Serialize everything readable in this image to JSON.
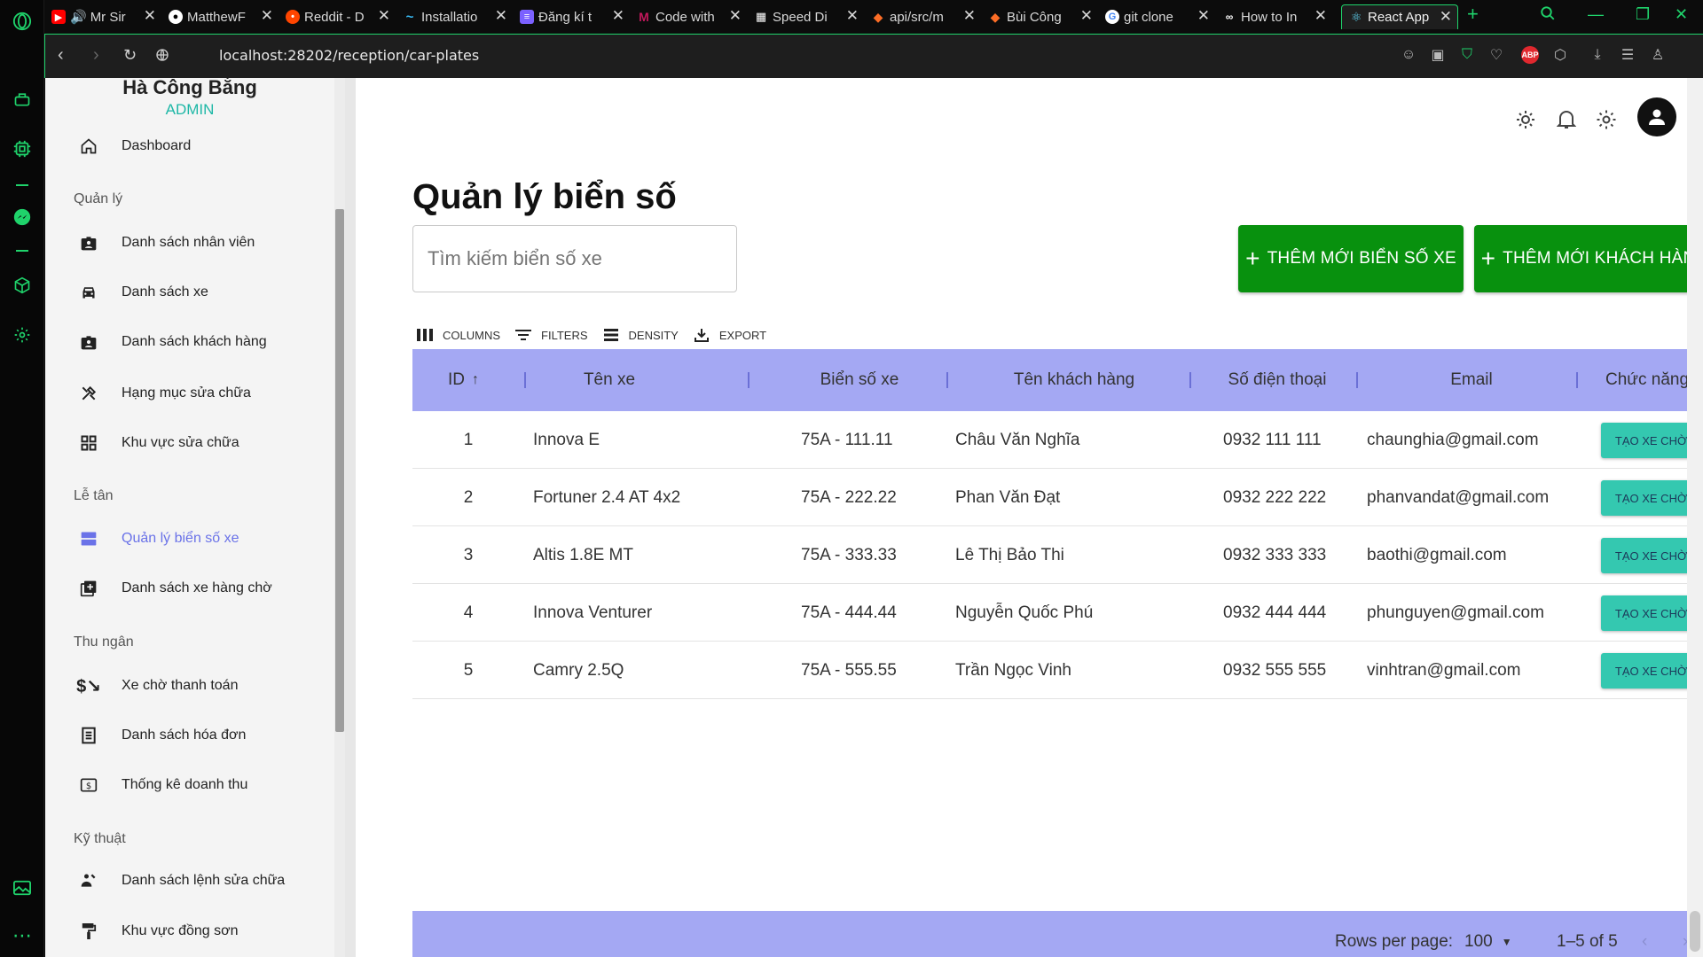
{
  "browser": {
    "tabs": [
      {
        "label": "Mr Sir",
        "favicon_color": "#ff0000"
      },
      {
        "label": "MatthewF",
        "favicon_color": "#ffffff"
      },
      {
        "label": "Reddit - D",
        "favicon_color": "#ff4500"
      },
      {
        "label": "Installatio",
        "favicon_color": "#38bdf8"
      },
      {
        "label": "Đăng kí t",
        "favicon_color": "#7b61ff"
      },
      {
        "label": "Code with",
        "favicon_color": "#c2185b"
      },
      {
        "label": "Speed Di",
        "favicon_color": "#ffffff"
      },
      {
        "label": "api/src/m",
        "favicon_color": "#fc6d26"
      },
      {
        "label": "Bùi Công",
        "favicon_color": "#fc6d26"
      },
      {
        "label": "git clone",
        "favicon_color": "#4285f4"
      },
      {
        "label": "How to In",
        "favicon_color": "#ffffff"
      },
      {
        "label": "React App",
        "favicon_color": "#61dafb"
      }
    ],
    "url": "localhost:28202/reception/car-plates",
    "accent": "#1fd36b"
  },
  "sidebar": {
    "user_name": "Hà Công Bằng",
    "user_role": "ADMIN",
    "dashboard": "Dashboard",
    "sections": {
      "manage": "Quản lý",
      "reception": "Lễ tân",
      "cashier": "Thu ngân",
      "technical": "Kỹ thuật"
    },
    "items": {
      "staff": "Danh sách nhân viên",
      "cars": "Danh sách xe",
      "customers": "Danh sách khách hàng",
      "repair_categories": "Hạng mục sửa chữa",
      "repair_areas": "Khu vực sửa chữa",
      "plates": "Quản lý biển số xe",
      "queue": "Danh sách xe hàng chờ",
      "awaiting_payment": "Xe chờ thanh toán",
      "invoices": "Danh sách hóa đơn",
      "revenue": "Thống kê doanh thu",
      "repair_orders": "Danh sách lệnh sửa chữa",
      "paint_area": "Khu vực đồng sơn"
    }
  },
  "main": {
    "title": "Quản lý biển số",
    "search_placeholder": "Tìm kiếm biển số xe",
    "add_plate": "THÊM MỚI BIỂN SỐ XE",
    "add_customer": "THÊM MỚI KHÁCH HÀNG",
    "toolbar": {
      "columns": "COLUMNS",
      "filters": "FILTERS",
      "density": "DENSITY",
      "export": "EXPORT"
    },
    "columns": [
      "ID",
      "Tên xe",
      "Biển số xe",
      "Tên khách hàng",
      "Số điện thoại",
      "Email",
      "Chức năng"
    ],
    "rows": [
      {
        "id": "1",
        "car": "Innova E",
        "plate": "75A - 111.11",
        "customer": "Châu Văn Nghĩa",
        "phone": "0932 111 111",
        "email": "chaunghia@gmail.com",
        "action": "TẠO XE CHỜ"
      },
      {
        "id": "2",
        "car": "Fortuner 2.4 AT 4x2",
        "plate": "75A - 222.22",
        "customer": "Phan Văn Đạt",
        "phone": "0932 222 222",
        "email": "phanvandat@gmail.com",
        "action": "TẠO XE CHỜ"
      },
      {
        "id": "3",
        "car": "Altis 1.8E MT",
        "plate": "75A - 333.33",
        "customer": "Lê Thị Bảo Thi",
        "phone": "0932 333 333",
        "email": "baothi@gmail.com",
        "action": "TẠO XE CHỜ"
      },
      {
        "id": "4",
        "car": "Innova Venturer",
        "plate": "75A - 444.44",
        "customer": "Nguyễn Quốc Phú",
        "phone": "0932 444 444",
        "email": "phunguyen@gmail.com",
        "action": "TẠO XE CHỜ"
      },
      {
        "id": "5",
        "car": "Camry 2.5Q",
        "plate": "75A - 555.55",
        "customer": "Trần Ngọc Vinh",
        "phone": "0932 555 555",
        "email": "vinhtran@gmail.com",
        "action": "TẠO XE CHỜ"
      }
    ],
    "footer": {
      "rows_per_page_label": "Rows per page:",
      "rows_per_page": "100",
      "range": "1–5 of 5"
    }
  },
  "colors": {
    "header_bg": "#a4a8f3",
    "primary_green": "#08910e",
    "teal_action": "#34c8b0",
    "active_nav": "#6a72e8",
    "role_color": "#1db7a6"
  }
}
